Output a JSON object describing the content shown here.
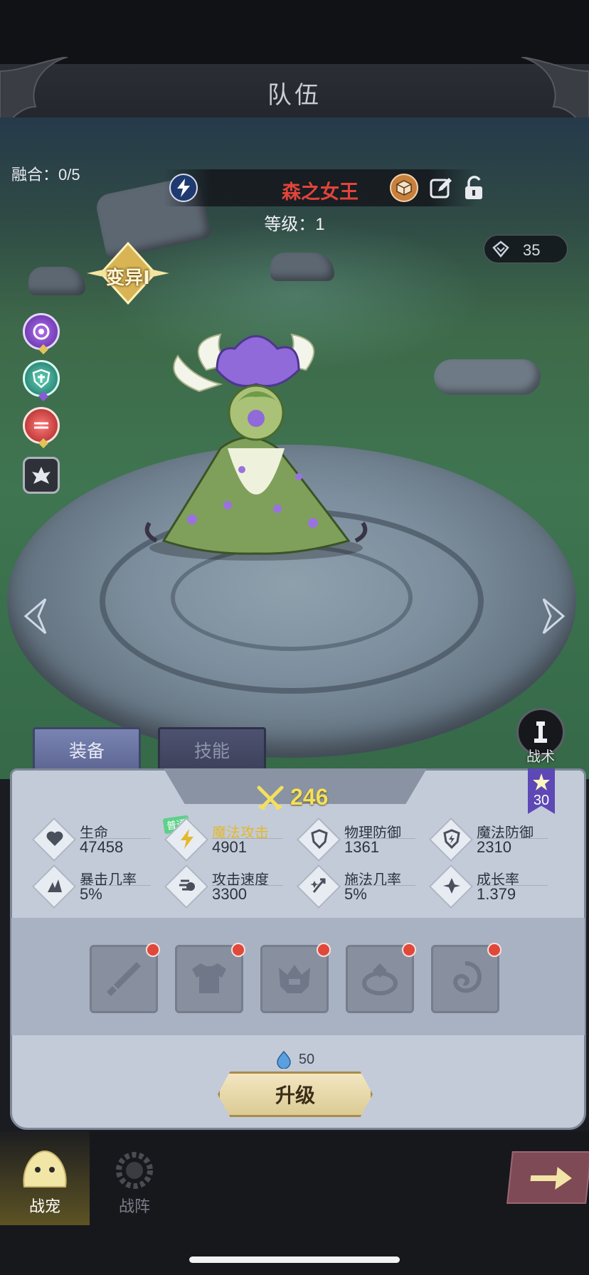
{
  "header": {
    "title": "队伍"
  },
  "fusion": "融合：0/5",
  "pet": {
    "name": "森之女王",
    "level": "等级：1",
    "element_icon": "lightning-icon",
    "mutation": "变异Ⅰ"
  },
  "soul_currency": {
    "icon": "crystal-icon",
    "value": "35"
  },
  "side_icons": [
    "magic-rune-icon",
    "shield-cross-icon",
    "red-orb-icon",
    "silver-crest-icon"
  ],
  "tactic": {
    "label": "战术"
  },
  "tabs": [
    {
      "label": "装备",
      "active": true
    },
    {
      "label": "技能",
      "active": false
    }
  ],
  "power": {
    "value": "246"
  },
  "star_level": "30",
  "normal_tag": "普通",
  "stats": [
    {
      "label": "生命",
      "value": "47458",
      "icon": "heart-icon"
    },
    {
      "label": "魔法攻击",
      "value": "4901",
      "icon": "lightning-icon",
      "highlight": true
    },
    {
      "label": "物理防御",
      "value": "1361",
      "icon": "shield-icon"
    },
    {
      "label": "魔法防御",
      "value": "2310",
      "icon": "magic-shield-icon"
    },
    {
      "label": "暴击几率",
      "value": "5%",
      "icon": "crit-icon"
    },
    {
      "label": "攻击速度",
      "value": "3300",
      "icon": "speed-icon"
    },
    {
      "label": "施法几率",
      "value": "5%",
      "icon": "cast-icon"
    },
    {
      "label": "成长率",
      "value": "1.379",
      "icon": "growth-icon"
    }
  ],
  "equipment": [
    "sword-icon",
    "armor-icon",
    "helmet-icon",
    "ring-icon",
    "charm-icon"
  ],
  "upgrade": {
    "cost": "50",
    "label": "升级"
  },
  "bottom_nav": [
    {
      "label": "战宠",
      "active": true
    },
    {
      "label": "战阵",
      "active": false
    }
  ],
  "colors": {
    "pet_name": "#e0443a",
    "power": "#f3e05c",
    "highlight_stat": "#e3b82a",
    "notify": "#e0483a"
  }
}
